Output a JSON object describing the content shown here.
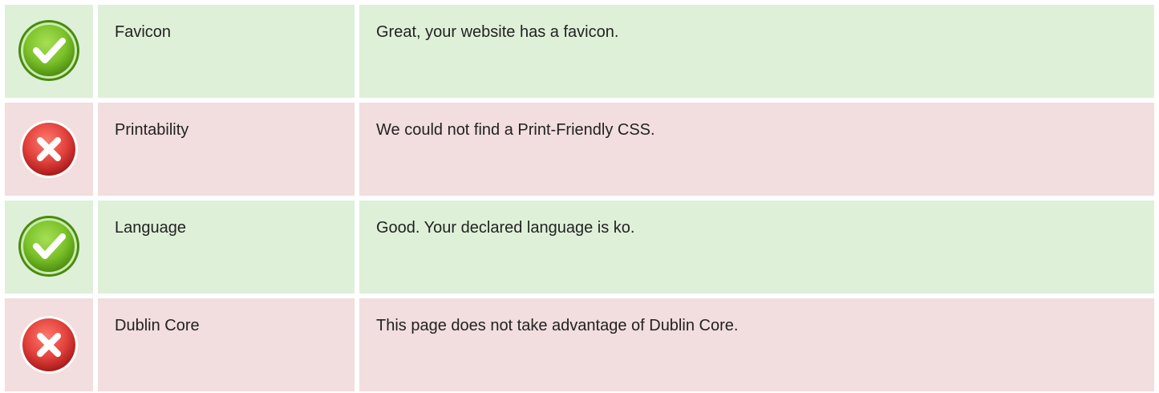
{
  "rows": [
    {
      "status": "pass",
      "icon": "check-icon",
      "name": "Favicon",
      "description": "Great, your website has a favicon."
    },
    {
      "status": "fail",
      "icon": "cross-icon",
      "name": "Printability",
      "description": "We could not find a Print-Friendly CSS."
    },
    {
      "status": "pass",
      "icon": "check-icon",
      "name": "Language",
      "description": "Good. Your declared language is ko."
    },
    {
      "status": "fail",
      "icon": "cross-icon",
      "name": "Dublin Core",
      "description": "This page does not take advantage of Dublin Core."
    }
  ],
  "colors": {
    "pass_bg": "#dff0d8",
    "fail_bg": "#f2dede",
    "pass_icon": "#7cc22a",
    "fail_icon": "#e2413c"
  }
}
